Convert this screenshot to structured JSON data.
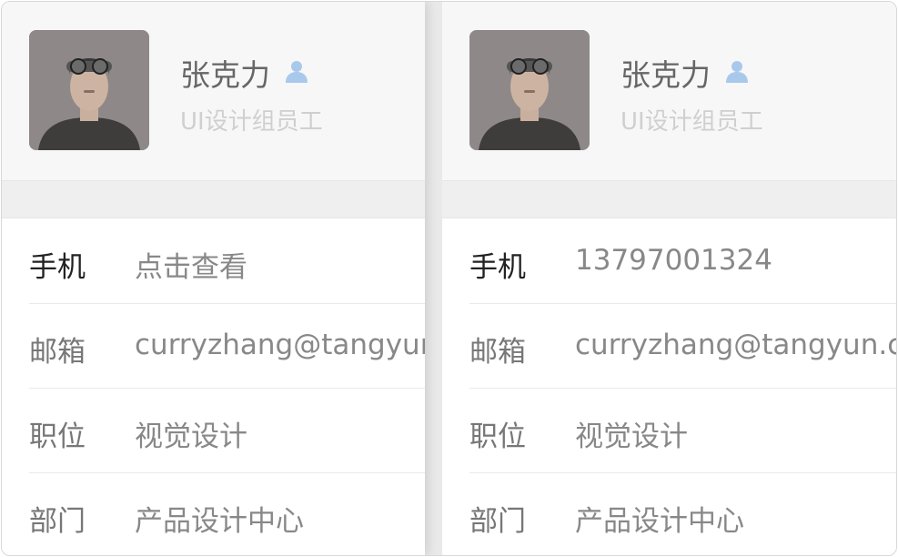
{
  "colors": {
    "link": "#3a73b8",
    "phone_number": "#2f5f9e",
    "email": "#9eb6d6",
    "name": "#666666",
    "subtitle": "#cfcfcf",
    "person_icon": "#a9c9ec"
  },
  "panels": [
    {
      "profile": {
        "name": "张克力",
        "subtitle": "UI设计组员工",
        "name_icon": "person-icon"
      },
      "fields": {
        "phone_label": "手机",
        "phone_value": "点击查看",
        "email_label": "邮箱",
        "email_value": "curryzhang@tangyun",
        "position_label": "职位",
        "position_value": "视觉设计",
        "department_label": "部门",
        "department_value": "产品设计中心"
      }
    },
    {
      "profile": {
        "name": "张克力",
        "subtitle": "UI设计组员工",
        "name_icon": "person-icon"
      },
      "fields": {
        "phone_label": "手机",
        "phone_value": "13797001324",
        "email_label": "邮箱",
        "email_value": "curryzhang@tangyun.c",
        "position_label": "职位",
        "position_value": "视觉设计",
        "department_label": "部门",
        "department_value": "产品设计中心"
      }
    }
  ]
}
